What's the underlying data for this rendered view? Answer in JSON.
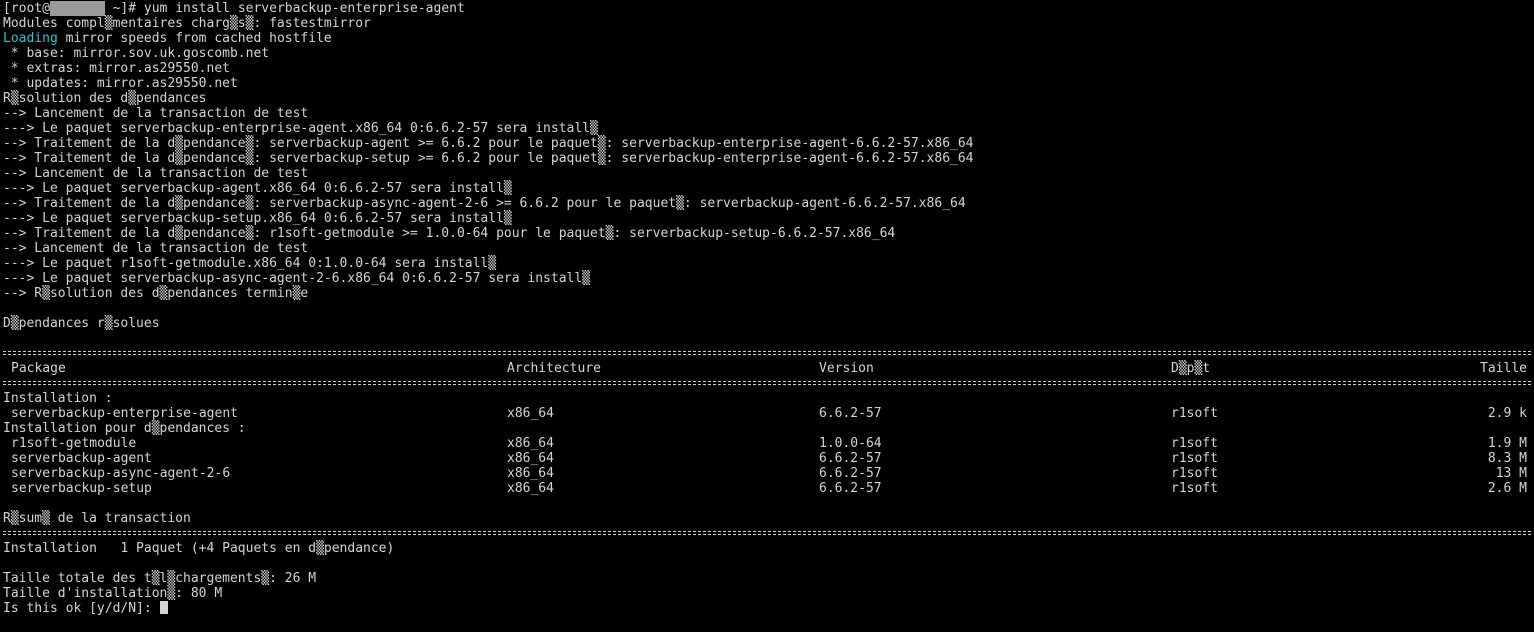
{
  "prompt": {
    "user_prefix": "[root@",
    "host_blurred": "ns27167",
    "suffix": " ~]# ",
    "command": "yum install serverbackup-enterprise-agent"
  },
  "log_top": [
    "Modules compl▒mentaires charg▒s▒: fastestmirror"
  ],
  "loading": {
    "highlight": "Loading",
    "rest": " mirror speeds from cached hostfile"
  },
  "log_mid": [
    " * base: mirror.sov.uk.goscomb.net",
    " * extras: mirror.as29550.net",
    " * updates: mirror.as29550.net",
    "R▒solution des d▒pendances",
    "--> Lancement de la transaction de test",
    "---> Le paquet serverbackup-enterprise-agent.x86_64 0:6.6.2-57 sera install▒",
    "--> Traitement de la d▒pendance▒: serverbackup-agent >= 6.6.2 pour le paquet▒: serverbackup-enterprise-agent-6.6.2-57.x86_64",
    "--> Traitement de la d▒pendance▒: serverbackup-setup >= 6.6.2 pour le paquet▒: serverbackup-enterprise-agent-6.6.2-57.x86_64",
    "--> Lancement de la transaction de test",
    "---> Le paquet serverbackup-agent.x86_64 0:6.6.2-57 sera install▒",
    "--> Traitement de la d▒pendance▒: serverbackup-async-agent-2-6 >= 6.6.2 pour le paquet▒: serverbackup-agent-6.6.2-57.x86_64",
    "---> Le paquet serverbackup-setup.x86_64 0:6.6.2-57 sera install▒",
    "--> Traitement de la d▒pendance▒: r1soft-getmodule >= 1.0.0-64 pour le paquet▒: serverbackup-setup-6.6.2-57.x86_64",
    "--> Lancement de la transaction de test",
    "---> Le paquet r1soft-getmodule.x86_64 0:1.0.0-64 sera install▒",
    "---> Le paquet serverbackup-async-agent-2-6.x86_64 0:6.6.2-57 sera install▒",
    "--> R▒solution des d▒pendances termin▒e",
    "",
    "D▒pendances r▒solues",
    ""
  ],
  "table": {
    "headers": [
      "Package",
      "Architecture",
      "Version",
      "D▒p▒t",
      "Taille"
    ],
    "install_label": "Installation :",
    "install_rows": [
      [
        "serverbackup-enterprise-agent",
        "x86_64",
        "6.6.2-57",
        "r1soft",
        "2.9 k"
      ]
    ],
    "deps_label": "Installation pour d▒pendances :",
    "dep_rows": [
      [
        "r1soft-getmodule",
        "x86_64",
        "1.0.0-64",
        "r1soft",
        "1.9 M"
      ],
      [
        "serverbackup-agent",
        "x86_64",
        "6.6.2-57",
        "r1soft",
        "8.3 M"
      ],
      [
        "serverbackup-async-agent-2-6",
        "x86_64",
        "6.6.2-57",
        "r1soft",
        "13 M"
      ],
      [
        "serverbackup-setup",
        "x86_64",
        "6.6.2-57",
        "r1soft",
        "2.6 M"
      ]
    ]
  },
  "summary_title": "R▒sum▒ de la transaction",
  "summary_lines": [
    "Installation   1 Paquet (+4 Paquets en d▒pendance)",
    "",
    "Taille totale des t▒l▒chargements▒: 26 M",
    "Taille d'installation▒: 80 M"
  ],
  "confirm_prompt": "Is this ok [y/d/N]: ",
  "colors": {
    "background": "#000000",
    "text": "#d4d4d4",
    "highlight": "#2fc4cf"
  }
}
